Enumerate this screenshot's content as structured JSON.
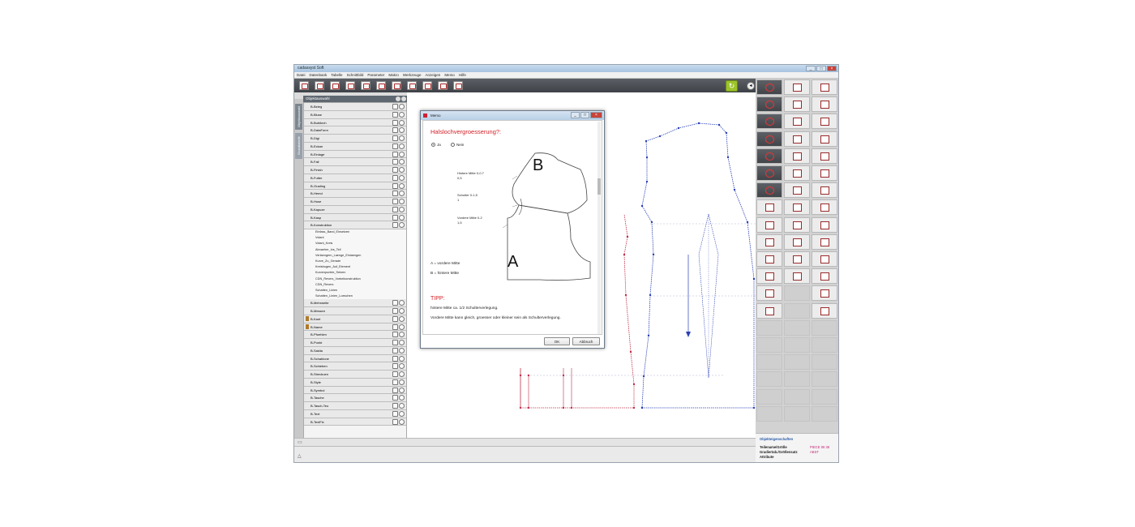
{
  "window": {
    "title": "cadassyst Soft"
  },
  "menu": [
    "Datei",
    "Datenbank",
    "Tabelle",
    "Schnittbild",
    "Parameter",
    "Makro",
    "Werkzeuge",
    "Anzeigen",
    "Memo",
    "Hilfe"
  ],
  "left_panel": {
    "title": "Objektauswahl",
    "side_tabs": [
      "Objektauswahl",
      "Grundtabelle"
    ],
    "items_top": [
      "B-Beleg",
      "B-Bluse",
      "B-Bubikrch",
      "B-DataForm",
      "B-Digi",
      "B-Eckan",
      "B-Einlage",
      "B-Fall",
      "B-Finish",
      "B-Futter",
      "B-Grading",
      "B-Hemd",
      "B-Hose",
      "B-Kapuze",
      "B-Kasp",
      "B-Konstruktion"
    ],
    "sub_items": [
      "Einfass_Band_Einsetzen",
      "Volant",
      "Volant_Kreis",
      "Abnaeher_Ins_Teil",
      "Verlaengern_Laenge_Einlaengen",
      "Kurve_Zu_Gerade",
      "Kreisbogen_Auf_Element",
      "Kurvenpunkte_Setzen",
      "CDN_Revers_Vorbeikonstruktion",
      "CDN_Revers",
      "Schatten_Linien",
      "Schatten_Linien_Loeschen"
    ],
    "items_bottom": [
      "B-Mehrweite",
      "B-Messen",
      "B-Kant",
      "B-Name",
      "B-Pfuehlen",
      "B-Punkt",
      "B-Saklia",
      "B-Schablone",
      "B-Schieben",
      "B-Streckuen",
      "B-Style",
      "B-Symbol",
      "B-Tasche",
      "B-Tasch-Teo",
      "B-Text",
      "B-TextFix"
    ]
  },
  "dialog": {
    "title": "Memo",
    "question": "Halslochvergroesserung?:",
    "option_yes": "Ja",
    "option_no": "Nein",
    "labels": {
      "hintere_mitte": "Hintere Mitte 0-0.7",
      "hintere_mitte_val": "0,5",
      "schulter": "Schulter 0-1,5",
      "schulter_val": "1",
      "vordere_mitte": "Vordere Mitte 0-2",
      "vordere_mitte_val": "1,5"
    },
    "big_a": "A",
    "big_b": "B",
    "legend_a": "A = vordere Mitte",
    "legend_b": "B = hintere Mitte",
    "tipp_title": "TIPP:",
    "tipp_line1": "hintere Mitte ca. 1/2 Schulterverlegung.",
    "tipp_line2": "Vordere Mitte kann gleich, groesser oder kleiner sein als Schulterverlegung.",
    "ok": "OK",
    "cancel": "Abbruch"
  },
  "props": {
    "header": "Objekteigenschaften",
    "rows": [
      {
        "label": "Teilename/Größe",
        "value": "PIECE 06 36"
      },
      {
        "label": "Gradiertab./Größensatz",
        "value": "ABST"
      },
      {
        "label": "Attribute",
        "value": ""
      }
    ]
  },
  "colors": {
    "pattern_red": "#c0304a",
    "pattern_blue": "#2a3fb5",
    "accent_red": "#d21f26",
    "toolbar_dark": "#41454a"
  }
}
